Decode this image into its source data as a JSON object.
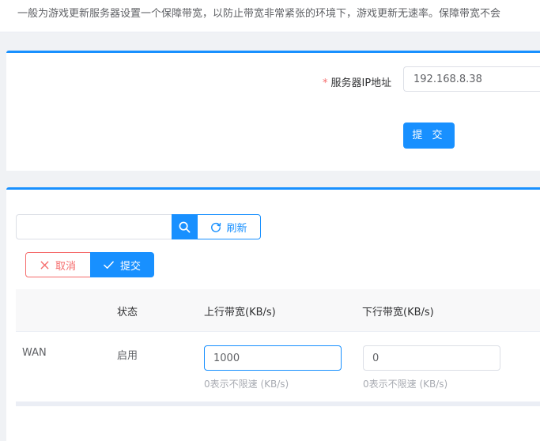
{
  "description": "一般为游戏更新服务器设置一个保障带宽，以防止带宽非常紧张的环境下，游戏更新无速率。保障带宽不会",
  "server_form": {
    "required_mark": "*",
    "ip_label": "服务器IP地址",
    "ip_value": "192.168.8.38",
    "submit_label": "提 交"
  },
  "toolbar": {
    "search_value": "",
    "refresh_label": "刷新",
    "cancel_label": "取消",
    "submit_label": "提交"
  },
  "table": {
    "columns": [
      "",
      "状态",
      "上行带宽(KB/s)",
      "下行带宽(KB/s)"
    ],
    "rows": [
      {
        "name": "WAN",
        "status": "启用",
        "upload": "1000",
        "upload_hint": "0表示不限速 (KB/s)",
        "download": "0",
        "download_hint": "0表示不限速 (KB/s)"
      }
    ]
  },
  "colors": {
    "primary": "#1890ff",
    "danger": "#f56c6c",
    "required": "#f56c6c"
  },
  "icons": [
    "search-icon",
    "refresh-icon",
    "close-icon",
    "check-icon"
  ]
}
